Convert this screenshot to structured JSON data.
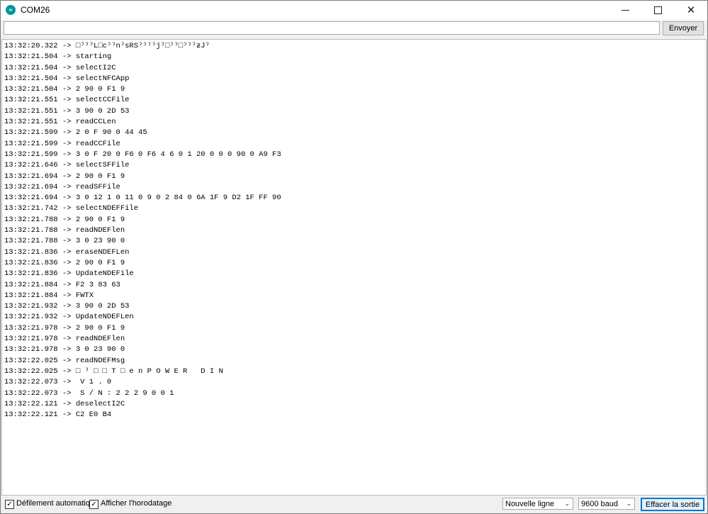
{
  "window": {
    "title": "COM26",
    "icon": "arduino-logo-icon",
    "controls": {
      "minimize": "minimize-icon",
      "maximize": "maximize-icon",
      "close": "close-icon"
    }
  },
  "send": {
    "input_value": "",
    "input_placeholder": "",
    "button_label": "Envoyer"
  },
  "log": [
    "13:32:20.322 -> □ˀˀˀL□cˀˀnˀsRSˀˀˀˀjˀ□ˀˀ□ˀˀˀƶJˀ",
    "13:32:21.504 -> starting",
    "13:32:21.504 -> selectI2C",
    "13:32:21.504 -> selectNFCApp",
    "13:32:21.504 -> 2 90 0 F1 9",
    "13:32:21.551 -> selectCCFile",
    "13:32:21.551 -> 3 90 0 2D 53",
    "13:32:21.551 -> readCCLen",
    "13:32:21.599 -> 2 0 F 90 0 44 45",
    "13:32:21.599 -> readCCFile",
    "13:32:21.599 -> 3 0 F 20 0 F6 0 F6 4 6 0 1 20 0 0 0 90 0 A9 F3",
    "13:32:21.646 -> selectSFFile",
    "13:32:21.694 -> 2 90 0 F1 9",
    "13:32:21.694 -> readSFFile",
    "13:32:21.694 -> 3 0 12 1 0 11 0 9 0 2 84 0 6A 1F 9 D2 1F FF 90",
    "13:32:21.742 -> selectNDEFFile",
    "13:32:21.788 -> 2 90 0 F1 9",
    "13:32:21.788 -> readNDEFlen",
    "13:32:21.788 -> 3 0 23 90 0",
    "13:32:21.836 -> eraseNDEFLen",
    "13:32:21.836 -> 2 90 0 F1 9",
    "13:32:21.836 -> UpdateNDEFile",
    "13:32:21.884 -> F2 3 83 63",
    "13:32:21.884 -> FWTX",
    "13:32:21.932 -> 3 90 0 2D 53",
    "13:32:21.932 -> UpdateNDEFLen",
    "13:32:21.978 -> 2 90 0 F1 9",
    "13:32:21.978 -> readNDEFlen",
    "13:32:21.978 -> 3 0 23 90 0",
    "13:32:22.025 -> readNDEFMsg",
    "13:32:22.025 -> □ ˀ □ □ T □ e n P O W E R   D I N",
    "13:32:22.073 ->  V 1 . 0",
    "13:32:22.073 ->  S / N : 2 2 2 9 0 0 1",
    "13:32:22.121 -> deselectI2C",
    "13:32:22.121 -> C2 E0 B4"
  ],
  "bottom": {
    "autoscroll": {
      "label": "Défilement automatique",
      "checked": true
    },
    "timestamp": {
      "label": "Afficher l'horodatage",
      "checked": true
    },
    "line_ending": {
      "selected": "Nouvelle ligne"
    },
    "baud": {
      "selected": "9600 baud"
    },
    "clear_label": "Effacer la sortie",
    "check_mark": "✓"
  }
}
